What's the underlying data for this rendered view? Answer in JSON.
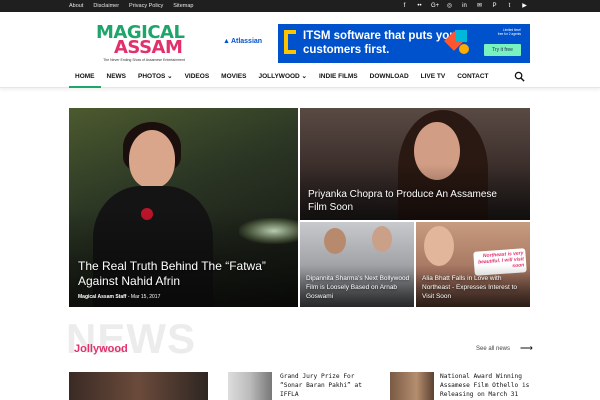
{
  "topbar": {
    "links": [
      "About",
      "Disclaimer",
      "Privacy Policy",
      "Sitemap"
    ],
    "social_icons": [
      "facebook-icon",
      "flickr-icon",
      "google-plus-icon",
      "instagram-icon",
      "linkedin-icon",
      "mail-icon",
      "pinterest-icon",
      "twitter-icon",
      "youtube-icon"
    ],
    "social_glyphs": [
      "f",
      "••",
      "G+",
      "◎",
      "in",
      "✉",
      "P",
      "t",
      "▶"
    ]
  },
  "logo": {
    "line1": "MAGICAL",
    "line2": "ASSAM",
    "tagline": "The Never Ending Show of Assamese Entertainment",
    "colors": {
      "line1": "#1fa56b",
      "line2": "#e2306c"
    }
  },
  "ad": {
    "brand": "Atlassian",
    "headline": "ITSM software that puts your customers first.",
    "fine_print": "Limited time! free for 2 agents",
    "cta": "Try it free"
  },
  "nav": {
    "items": [
      {
        "label": "HOME",
        "active": true
      },
      {
        "label": "NEWS"
      },
      {
        "label": "PHOTOS ⌄"
      },
      {
        "label": "VIDEOS"
      },
      {
        "label": "MOVIES"
      },
      {
        "label": "JOLLYWOOD ⌄"
      },
      {
        "label": "INDIE FILMS"
      },
      {
        "label": "DOWNLOAD"
      },
      {
        "label": "LIVE TV"
      },
      {
        "label": "CONTACT"
      }
    ]
  },
  "featured": {
    "main": {
      "title": "The Real Truth Behind The “Fatwa” Against Nahid Afrin",
      "author": "Magical Assam Staff",
      "date": "- Mar 15, 2017"
    },
    "top_right": {
      "title": "Priyanka Chopra to Produce An Assamese Film Soon"
    },
    "bottom_left": {
      "title": "Dipannita Sharma’s Next Bollywood Film is Loosely Based on Arnab Goswami"
    },
    "bottom_right": {
      "title": "Alia Bhatt Falls in Love with Northeast - Expresses Interest to Visit Soon",
      "bubble": "Northeast is very beautiful. I will visit soon"
    }
  },
  "section": {
    "bg_word": "NEWS",
    "title": "Jollywood",
    "see_all": "See all news",
    "accent": "#e2306c"
  },
  "list": {
    "item1": "Grand Jury Prize For “Sonar Baran Pakhi” at IFFLA",
    "item2": "National Award Winning Assamese Film Othello is Releasing on March 31"
  }
}
